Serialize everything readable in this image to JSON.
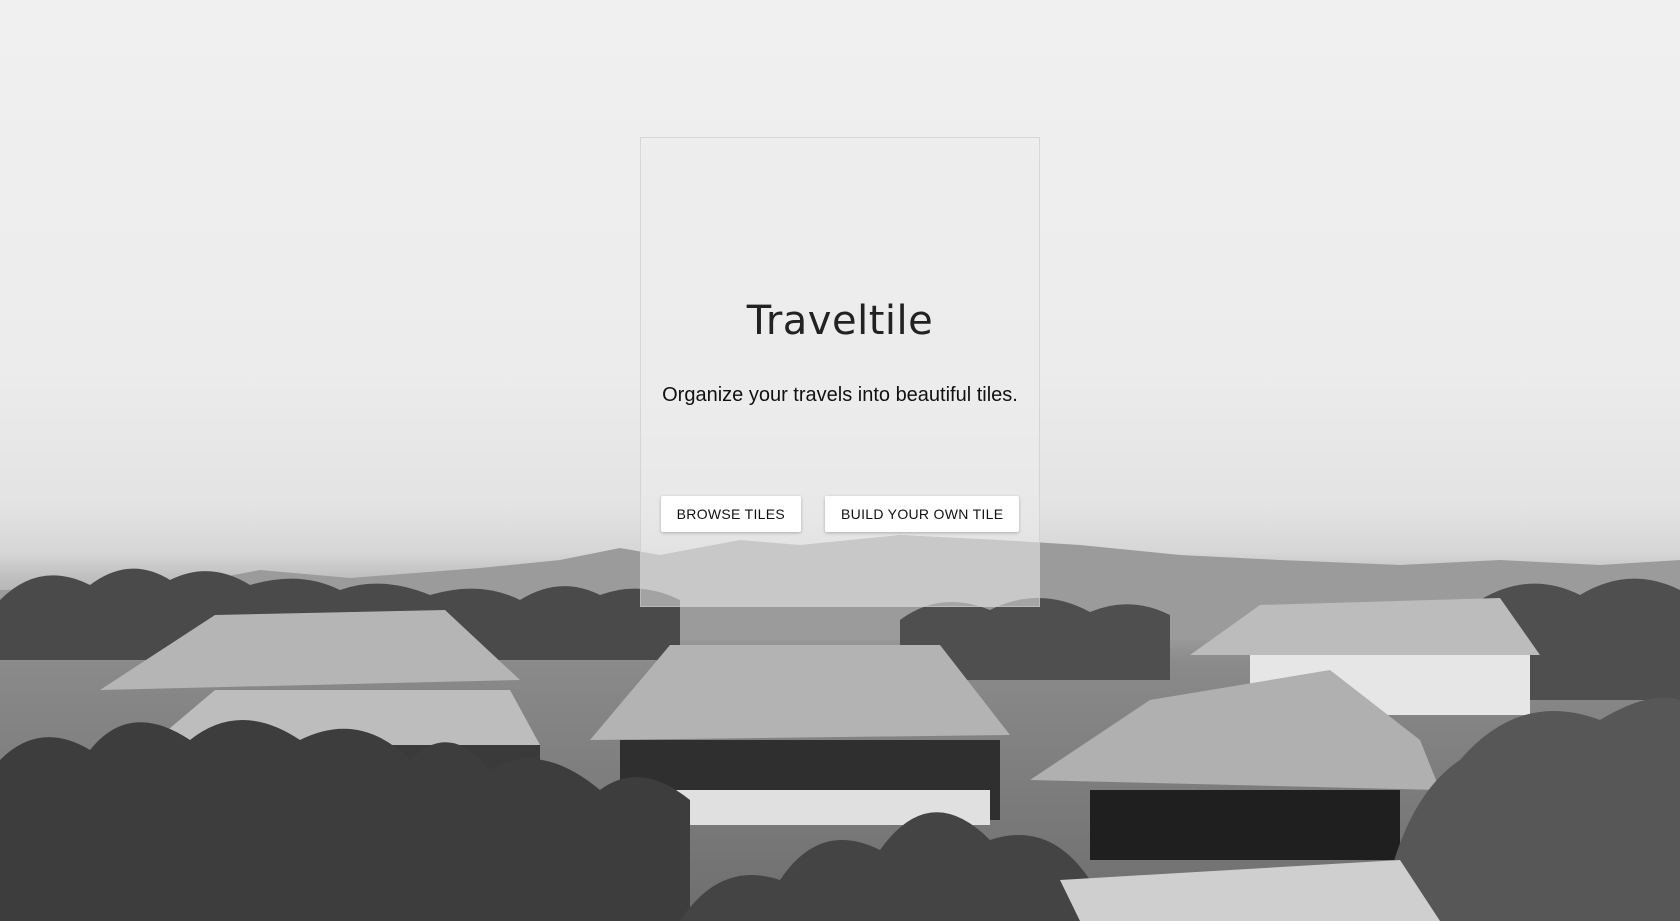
{
  "app": {
    "title": "Traveltile",
    "tagline": "Organize your travels into beautiful tiles."
  },
  "actions": {
    "browse_label": "BROWSE TILES",
    "build_label": "BUILD YOUR OWN TILE"
  },
  "background": {
    "icon": "temple-landscape-photo",
    "tone": "grayscale"
  }
}
